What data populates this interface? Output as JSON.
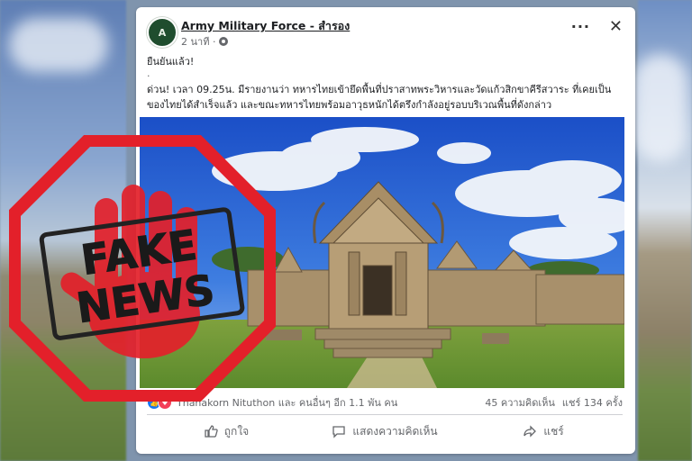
{
  "post": {
    "page_name": "Army Military Force - สำรอง",
    "avatar_initial": "A",
    "time": "2 นาที ·",
    "headline": "ยืนยันแล้ว!",
    "separator": ".",
    "body": "ด่วน! เวลา 09.25น. มีรายงานว่า ทหารไทยเข้ายึดพื้นที่ปราสาทพระวิหารและวัดแก้วสิกขาคีรีสวาระ ที่เคยเป็นของไทยได้สำเร็จแล้ว และขณะทหารไทยพร้อมอาวุธหนักได้ตรึงกำลังอยู่รอบบริเวณพื้นที่ดังกล่าว",
    "more_icon": "more-horizontal-icon",
    "close_icon": "close-icon"
  },
  "stats": {
    "reaction_text": "Thanakorn Nituthon และ คนอื่นๆ อีก 1.1 พัน คน",
    "comments": "45 ความคิดเห็น",
    "shares": "แชร์ 134 ครั้ง"
  },
  "actions": {
    "like": "ถูกใจ",
    "comment": "แสดงความคิดเห็น",
    "share": "แชร์"
  },
  "overlay": {
    "line1": "FAKE",
    "line2": "NEWS"
  },
  "colors": {
    "stop_red": "#e3202a",
    "facebook_blue": "#1877f2"
  }
}
